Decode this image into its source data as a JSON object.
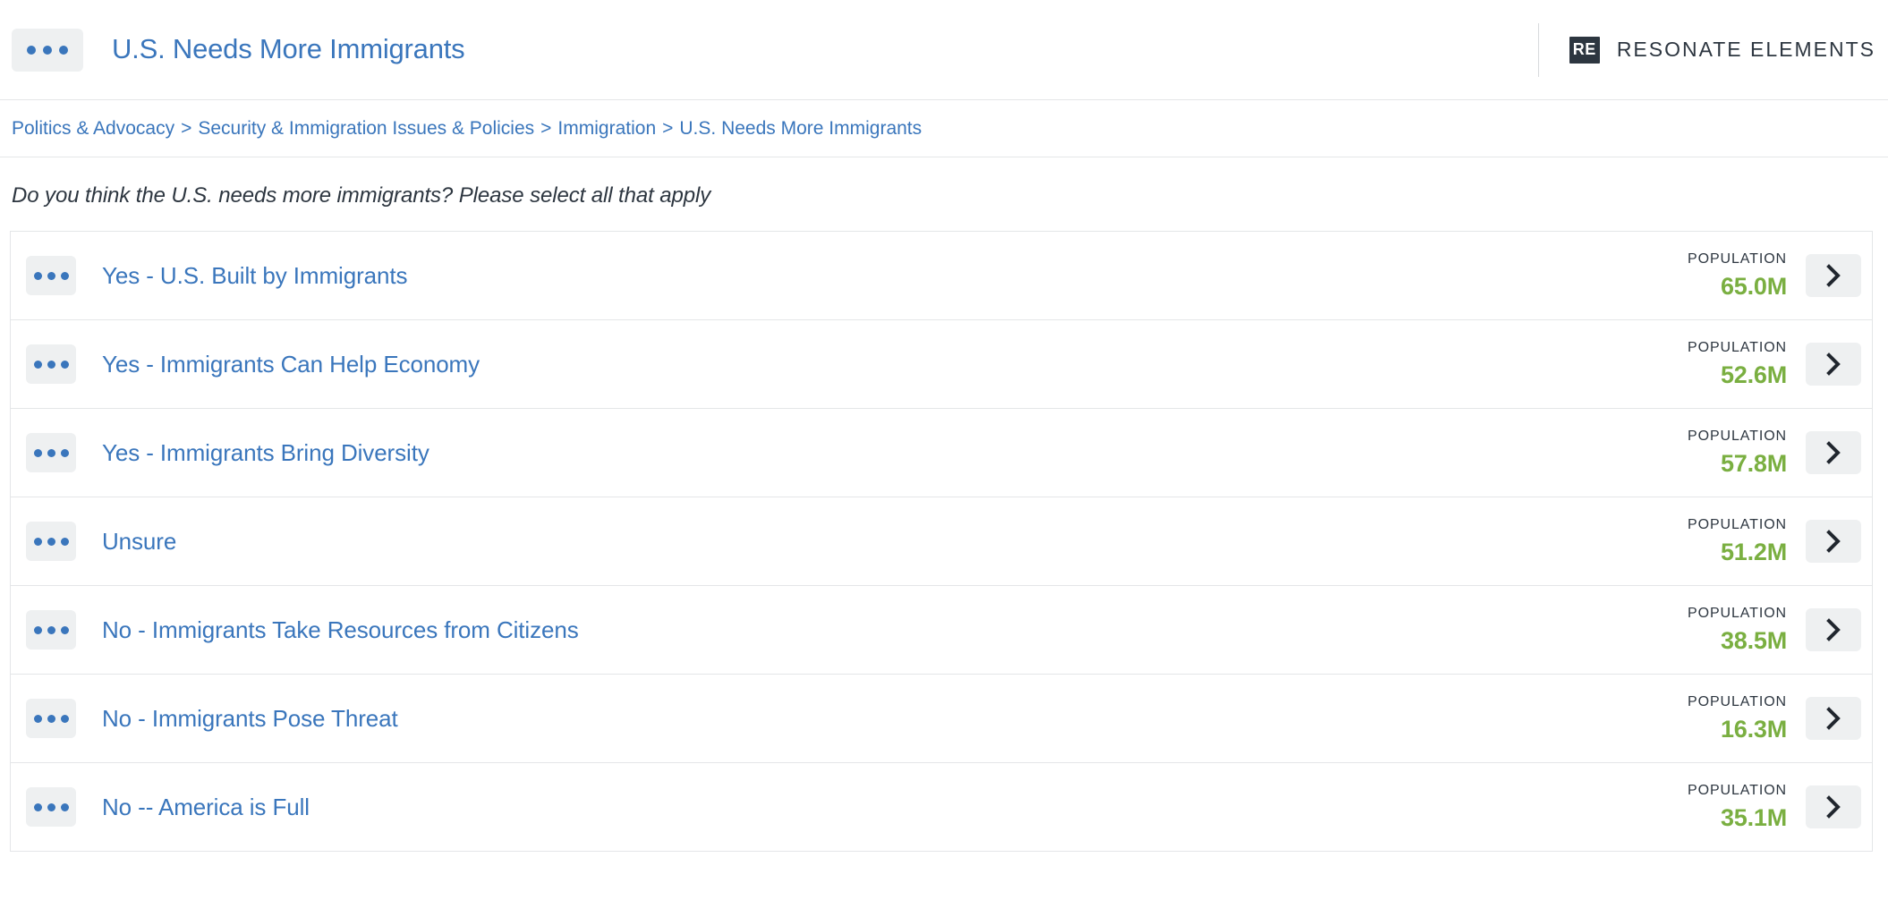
{
  "header": {
    "menu_icon": "ellipsis-icon",
    "title": "U.S. Needs More Immigrants",
    "logo_mark": "RE",
    "logo_text": "RESONATE ELEMENTS"
  },
  "breadcrumb": {
    "separator": ">",
    "items": [
      {
        "label": "Politics & Advocacy"
      },
      {
        "label": "Security & Immigration Issues & Policies"
      },
      {
        "label": "Immigration"
      },
      {
        "label": "U.S. Needs More Immigrants"
      }
    ]
  },
  "question": {
    "text": "Do you think the U.S. needs more immigrants? Please select all that apply"
  },
  "table": {
    "population_label": "POPULATION",
    "rows": [
      {
        "label": "Yes - U.S. Built by Immigrants",
        "population_label": "POPULATION",
        "population": "65.0M"
      },
      {
        "label": "Yes - Immigrants Can Help Economy",
        "population_label": "POPULATION",
        "population": "52.6M"
      },
      {
        "label": "Yes - Immigrants Bring Diversity",
        "population_label": "POPULATION",
        "population": "57.8M"
      },
      {
        "label": "Unsure",
        "population_label": "POPULATION",
        "population": "51.2M"
      },
      {
        "label": "No - Immigrants Take Resources from Citizens",
        "population_label": "POPULATION",
        "population": "38.5M"
      },
      {
        "label": "No - Immigrants Pose Threat",
        "population_label": "POPULATION",
        "population": "16.3M"
      },
      {
        "label": "No -- America is Full",
        "population_label": "POPULATION",
        "population": "35.1M"
      }
    ]
  },
  "colors": {
    "link_blue": "#3a76bc",
    "population_green": "#7aaf41",
    "ink": "#2d3640",
    "border": "#e4e6e8",
    "button_bg": "#eef0f1"
  }
}
